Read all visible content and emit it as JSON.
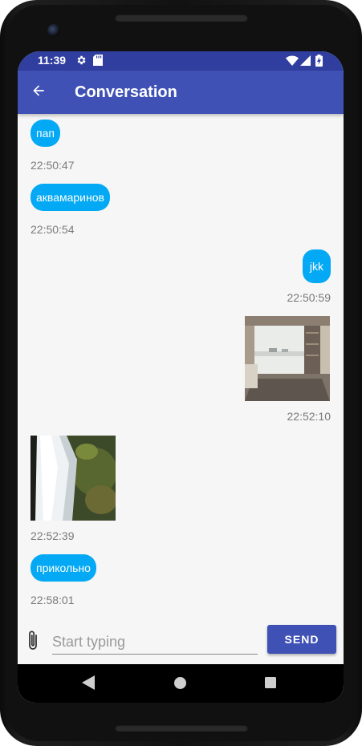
{
  "status_bar": {
    "time": "11:39",
    "icons": [
      "settings-gear-icon",
      "sd-card-icon",
      "wifi-icon",
      "cell-signal-icon",
      "battery-charging-icon"
    ]
  },
  "app_bar": {
    "back_icon": "arrow-back-icon",
    "title": "Conversation"
  },
  "messages": [
    {
      "side": "received",
      "type": "text",
      "text": "пап",
      "time": "22:50:47"
    },
    {
      "side": "received",
      "type": "text",
      "text": "аквамаринов",
      "time": "22:50:54"
    },
    {
      "side": "sent",
      "type": "text",
      "text": "jkk",
      "time": "22:50:59"
    },
    {
      "side": "sent",
      "type": "image",
      "image": "room-window-photo",
      "time": "22:52:10"
    },
    {
      "side": "received",
      "type": "image",
      "image": "waterfall-photo",
      "time": "22:52:39"
    },
    {
      "side": "received",
      "type": "text",
      "text": "прикольно",
      "time": "22:58:01"
    }
  ],
  "composer": {
    "attach_icon": "paperclip-icon",
    "placeholder": "Start typing",
    "value": "",
    "send_label": "SEND"
  },
  "nav_bar": {
    "icons": [
      "back-triangle-icon",
      "home-circle-icon",
      "recents-square-icon"
    ]
  },
  "colors": {
    "status_bar": "#303f9f",
    "app_bar": "#3f51b5",
    "bubble": "#03a9f4",
    "background": "#f6f6f6",
    "send_button": "#3f51b5"
  }
}
